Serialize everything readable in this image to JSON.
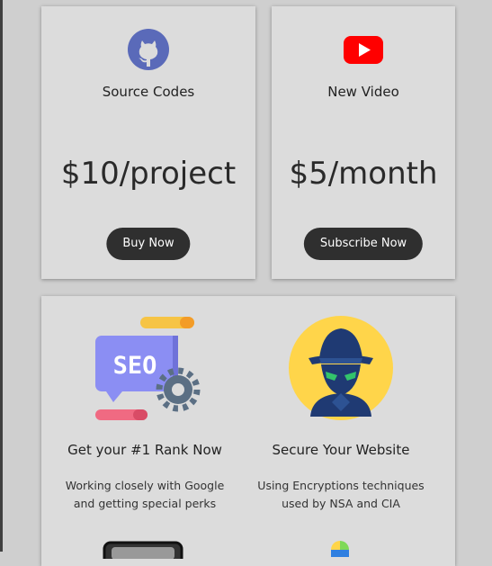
{
  "pricing": [
    {
      "title": "Source Codes",
      "price": "$10/project",
      "button": "Buy Now",
      "icon": "github-icon"
    },
    {
      "title": "New Video",
      "price": "$5/month",
      "button": "Subscribe Now",
      "icon": "youtube-icon"
    }
  ],
  "features": [
    {
      "title": "Get your #1 Rank Now",
      "desc_line1": "Working closely with Google",
      "desc_line2": "and getting special perks",
      "icon": "seo-icon",
      "icon_text": "SEO"
    },
    {
      "title": "Secure Your Website",
      "desc_line1": "Using Encryptions techniques",
      "desc_line2": "used by NSA and CIA",
      "icon": "spy-icon"
    }
  ],
  "colors": {
    "background": "#cfcfcf",
    "card": "#dcdcdc",
    "button": "#2f2f2f",
    "github": "#5a6ab9",
    "youtube": "#ff0000",
    "seo_board": "#8b8ef3",
    "spy_circle": "#ffd54a",
    "spy_figure": "#1f3a73"
  }
}
